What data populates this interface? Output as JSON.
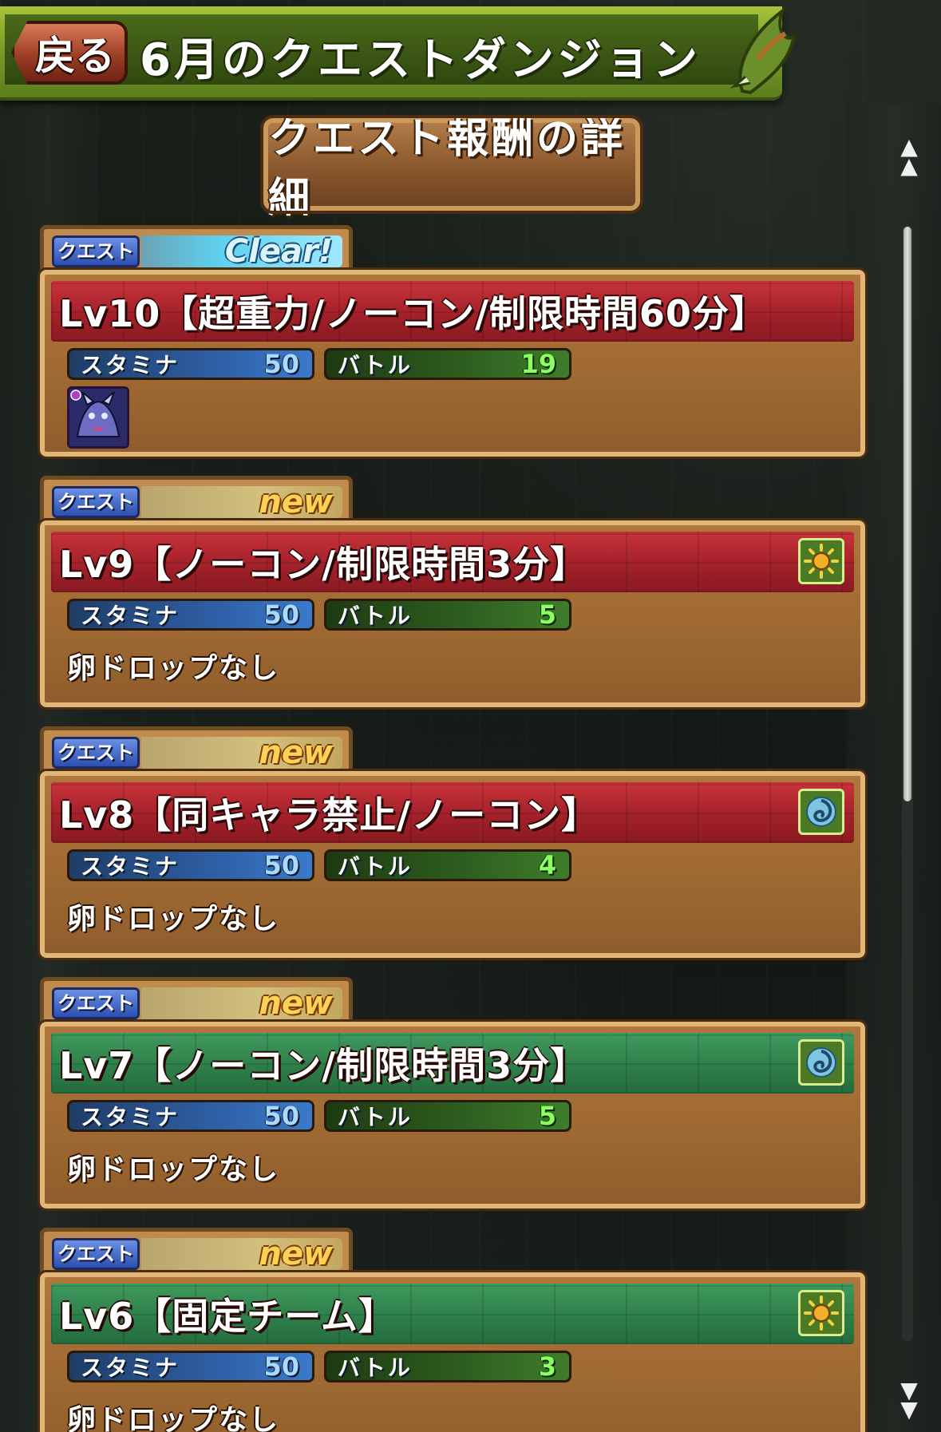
{
  "header": {
    "back_label": "戻る",
    "title": "6月のクエストダンジョン"
  },
  "reward_button": {
    "label": "クエスト報酬の詳細"
  },
  "scrollbar": {
    "up": "▲\n▲",
    "down": "▼\n▼",
    "up_glyph": "▲",
    "down_glyph": "▼"
  },
  "colors": {
    "header_green": "#7fa02a",
    "title_red": "#a3212a",
    "title_green": "#2e7f49",
    "panel_brown": "#9e6832",
    "status_new": "#ffd257",
    "status_clear": "#9fe8ff"
  },
  "quests": [
    {
      "tab_label": "クエスト",
      "status": "Clear!",
      "title": "Lv10【超重力/ノーコン/制限時間60分】",
      "title_color": "red",
      "stamina_label": "スタミナ",
      "stamina": "50",
      "battle_label": "バトル",
      "battle": "19",
      "attribute_icon": "",
      "drop": "monster-icon",
      "drop_text": ""
    },
    {
      "tab_label": "クエスト",
      "status": "new",
      "title": "Lv9【ノーコン/制限時間3分】",
      "title_color": "red",
      "stamina_label": "スタミナ",
      "stamina": "50",
      "battle_label": "バトル",
      "battle": "5",
      "attribute_icon": "light-attribute-icon",
      "drop_text": "卵ドロップなし"
    },
    {
      "tab_label": "クエスト",
      "status": "new",
      "title": "Lv8【同キャラ禁止/ノーコン】",
      "title_color": "red",
      "stamina_label": "スタミナ",
      "stamina": "50",
      "battle_label": "バトル",
      "battle": "4",
      "attribute_icon": "dark-water-attribute-icon",
      "drop_text": "卵ドロップなし"
    },
    {
      "tab_label": "クエスト",
      "status": "new",
      "title": "Lv7【ノーコン/制限時間3分】",
      "title_color": "green",
      "stamina_label": "スタミナ",
      "stamina": "50",
      "battle_label": "バトル",
      "battle": "5",
      "attribute_icon": "dark-water-attribute-icon",
      "drop_text": "卵ドロップなし"
    },
    {
      "tab_label": "クエスト",
      "status": "new",
      "title": "Lv6【固定チーム】",
      "title_color": "green",
      "stamina_label": "スタミナ",
      "stamina": "50",
      "battle_label": "バトル",
      "battle": "3",
      "attribute_icon": "light-attribute-icon",
      "drop_text": "卵ドロップなし"
    }
  ]
}
